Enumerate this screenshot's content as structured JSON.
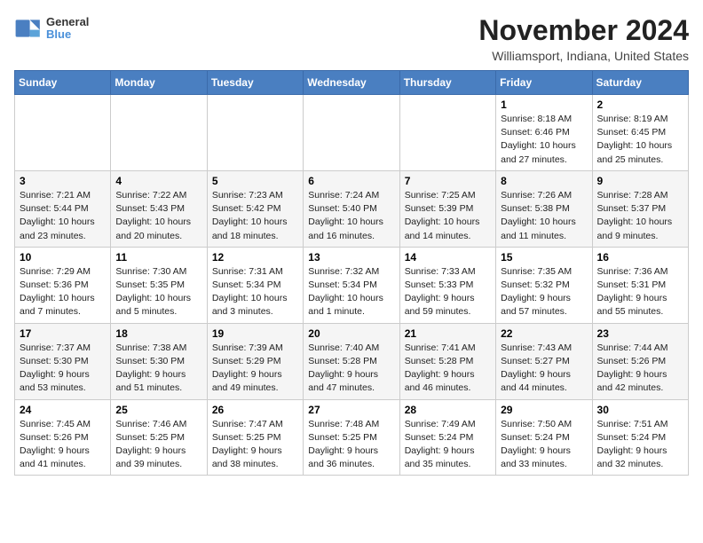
{
  "header": {
    "logo_general": "General",
    "logo_blue": "Blue",
    "title": "November 2024",
    "subtitle": "Williamsport, Indiana, United States"
  },
  "weekdays": [
    "Sunday",
    "Monday",
    "Tuesday",
    "Wednesday",
    "Thursday",
    "Friday",
    "Saturday"
  ],
  "weeks": [
    [
      {
        "day": "",
        "info": ""
      },
      {
        "day": "",
        "info": ""
      },
      {
        "day": "",
        "info": ""
      },
      {
        "day": "",
        "info": ""
      },
      {
        "day": "",
        "info": ""
      },
      {
        "day": "1",
        "info": "Sunrise: 8:18 AM\nSunset: 6:46 PM\nDaylight: 10 hours and 27 minutes."
      },
      {
        "day": "2",
        "info": "Sunrise: 8:19 AM\nSunset: 6:45 PM\nDaylight: 10 hours and 25 minutes."
      }
    ],
    [
      {
        "day": "3",
        "info": "Sunrise: 7:21 AM\nSunset: 5:44 PM\nDaylight: 10 hours and 23 minutes."
      },
      {
        "day": "4",
        "info": "Sunrise: 7:22 AM\nSunset: 5:43 PM\nDaylight: 10 hours and 20 minutes."
      },
      {
        "day": "5",
        "info": "Sunrise: 7:23 AM\nSunset: 5:42 PM\nDaylight: 10 hours and 18 minutes."
      },
      {
        "day": "6",
        "info": "Sunrise: 7:24 AM\nSunset: 5:40 PM\nDaylight: 10 hours and 16 minutes."
      },
      {
        "day": "7",
        "info": "Sunrise: 7:25 AM\nSunset: 5:39 PM\nDaylight: 10 hours and 14 minutes."
      },
      {
        "day": "8",
        "info": "Sunrise: 7:26 AM\nSunset: 5:38 PM\nDaylight: 10 hours and 11 minutes."
      },
      {
        "day": "9",
        "info": "Sunrise: 7:28 AM\nSunset: 5:37 PM\nDaylight: 10 hours and 9 minutes."
      }
    ],
    [
      {
        "day": "10",
        "info": "Sunrise: 7:29 AM\nSunset: 5:36 PM\nDaylight: 10 hours and 7 minutes."
      },
      {
        "day": "11",
        "info": "Sunrise: 7:30 AM\nSunset: 5:35 PM\nDaylight: 10 hours and 5 minutes."
      },
      {
        "day": "12",
        "info": "Sunrise: 7:31 AM\nSunset: 5:34 PM\nDaylight: 10 hours and 3 minutes."
      },
      {
        "day": "13",
        "info": "Sunrise: 7:32 AM\nSunset: 5:34 PM\nDaylight: 10 hours and 1 minute."
      },
      {
        "day": "14",
        "info": "Sunrise: 7:33 AM\nSunset: 5:33 PM\nDaylight: 9 hours and 59 minutes."
      },
      {
        "day": "15",
        "info": "Sunrise: 7:35 AM\nSunset: 5:32 PM\nDaylight: 9 hours and 57 minutes."
      },
      {
        "day": "16",
        "info": "Sunrise: 7:36 AM\nSunset: 5:31 PM\nDaylight: 9 hours and 55 minutes."
      }
    ],
    [
      {
        "day": "17",
        "info": "Sunrise: 7:37 AM\nSunset: 5:30 PM\nDaylight: 9 hours and 53 minutes."
      },
      {
        "day": "18",
        "info": "Sunrise: 7:38 AM\nSunset: 5:30 PM\nDaylight: 9 hours and 51 minutes."
      },
      {
        "day": "19",
        "info": "Sunrise: 7:39 AM\nSunset: 5:29 PM\nDaylight: 9 hours and 49 minutes."
      },
      {
        "day": "20",
        "info": "Sunrise: 7:40 AM\nSunset: 5:28 PM\nDaylight: 9 hours and 47 minutes."
      },
      {
        "day": "21",
        "info": "Sunrise: 7:41 AM\nSunset: 5:28 PM\nDaylight: 9 hours and 46 minutes."
      },
      {
        "day": "22",
        "info": "Sunrise: 7:43 AM\nSunset: 5:27 PM\nDaylight: 9 hours and 44 minutes."
      },
      {
        "day": "23",
        "info": "Sunrise: 7:44 AM\nSunset: 5:26 PM\nDaylight: 9 hours and 42 minutes."
      }
    ],
    [
      {
        "day": "24",
        "info": "Sunrise: 7:45 AM\nSunset: 5:26 PM\nDaylight: 9 hours and 41 minutes."
      },
      {
        "day": "25",
        "info": "Sunrise: 7:46 AM\nSunset: 5:25 PM\nDaylight: 9 hours and 39 minutes."
      },
      {
        "day": "26",
        "info": "Sunrise: 7:47 AM\nSunset: 5:25 PM\nDaylight: 9 hours and 38 minutes."
      },
      {
        "day": "27",
        "info": "Sunrise: 7:48 AM\nSunset: 5:25 PM\nDaylight: 9 hours and 36 minutes."
      },
      {
        "day": "28",
        "info": "Sunrise: 7:49 AM\nSunset: 5:24 PM\nDaylight: 9 hours and 35 minutes."
      },
      {
        "day": "29",
        "info": "Sunrise: 7:50 AM\nSunset: 5:24 PM\nDaylight: 9 hours and 33 minutes."
      },
      {
        "day": "30",
        "info": "Sunrise: 7:51 AM\nSunset: 5:24 PM\nDaylight: 9 hours and 32 minutes."
      }
    ]
  ]
}
